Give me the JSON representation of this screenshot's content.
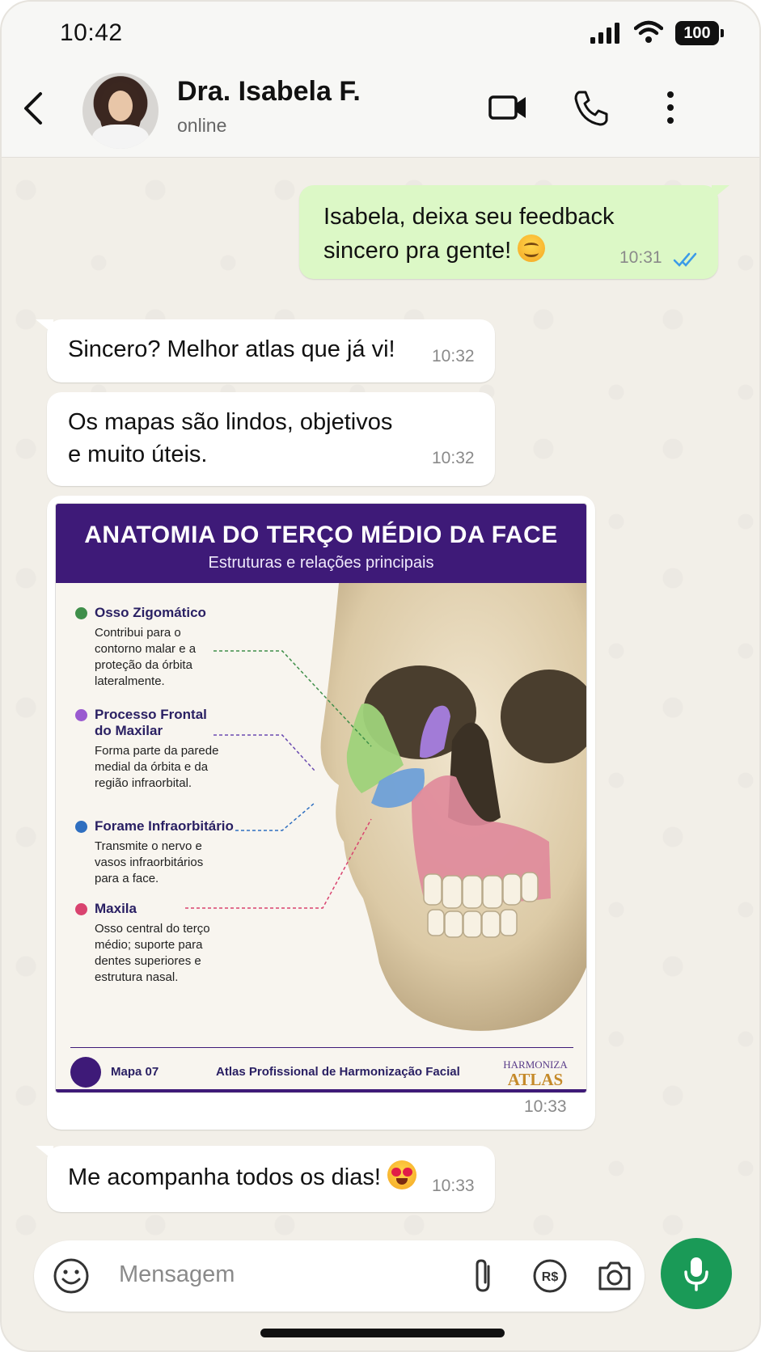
{
  "status_bar": {
    "time": "10:42",
    "battery": "100"
  },
  "header": {
    "contact_name": "Dra. Isabela F.",
    "contact_status": "online"
  },
  "messages": [
    {
      "direction": "out",
      "text_line1": "Isabela, deixa seu feedback",
      "text_line2": "sincero pra gente!",
      "emoji": "smiling-face",
      "time": "10:31",
      "read": true
    },
    {
      "direction": "in",
      "text": "Sincero? Melhor atlas que já vi!",
      "time": "10:32"
    },
    {
      "direction": "in",
      "text_line1": "Os mapas são lindos, objetivos",
      "text_line2": "e muito úteis.",
      "time": "10:32"
    },
    {
      "direction": "in",
      "type": "image",
      "time": "10:33"
    },
    {
      "direction": "in",
      "text": "Me acompanha todos os dias!",
      "emoji": "heart-eyes-face",
      "time": "10:33"
    }
  ],
  "poster": {
    "title": "ANATOMIA DO TERÇO MÉDIO DA FACE",
    "subtitle": "Estruturas e relações principais",
    "legend": [
      {
        "title": "Osso Zigomático",
        "desc": "Contribui para o contorno malar e a proteção da órbita lateralmente.",
        "color": "#3f8f4a"
      },
      {
        "title_line1": "Processo Frontal",
        "title_line2": "do Maxilar",
        "desc": "Forma parte da parede medial da órbita e da região infraorbital.",
        "color": "#9a5ad0"
      },
      {
        "title": "Forame Infraorbitário",
        "desc": "Transmite o nervo e vasos infraorbitários para a face.",
        "color": "#2f6fc0"
      },
      {
        "title": "Maxila",
        "desc": "Osso central do terço médio; suporte para dentes superiores e estrutura nasal.",
        "color": "#d9436f"
      }
    ],
    "footer_map": "Mapa 07",
    "footer_atlas": "Atlas Profissional de Harmonização Facial",
    "brand_line1": "HARMONIZA",
    "brand_line2": "ATLAS"
  },
  "input": {
    "placeholder": "Mensagem"
  },
  "colors": {
    "outgoing_bubble": "#dcf8c6",
    "mic_button": "#1a9a57",
    "poster_header": "#3e1a78",
    "read_ticks": "#3b9be8"
  }
}
